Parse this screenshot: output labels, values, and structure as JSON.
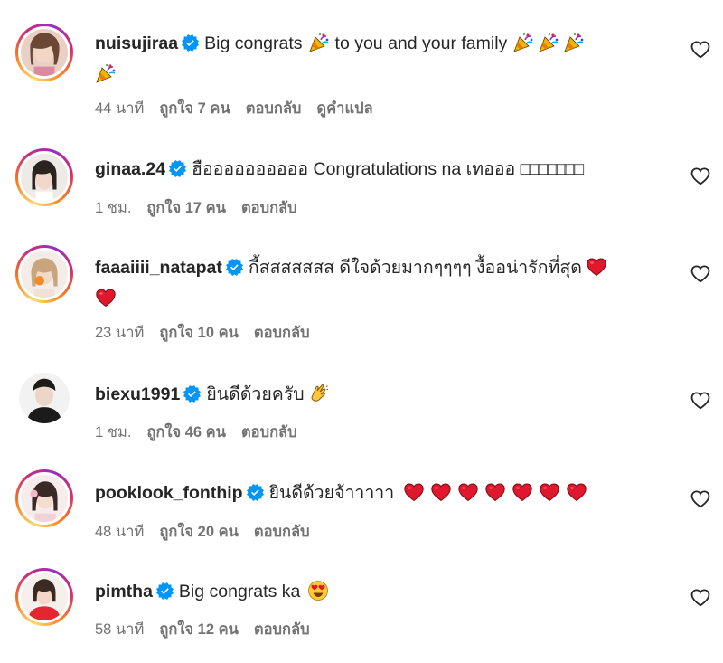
{
  "comments": [
    {
      "username": "nuisujiraa",
      "text": "Big congrats",
      "text_after": "to you and your family",
      "time": "44 นาที",
      "likes": "ถูกใจ 7 คน",
      "reply": "ตอบกลับ",
      "translate": "ดูคำแปล",
      "emoji": [
        "party-popper",
        "party-popper",
        "party-popper",
        "party-popper",
        "party-popper"
      ]
    },
    {
      "username": "ginaa.24",
      "text": "ฮืออออออออออ Congratulations na เทอออ",
      "tofu": "□□□□□□□",
      "time": "1 ชม.",
      "likes": "ถูกใจ 17 คน",
      "reply": "ตอบกลับ"
    },
    {
      "username": "faaaiiii_natapat",
      "text": "กี้สสสสสสส ดีใจด้วยมากๆๆๆๆ งื้ออน่ารักที่สุด",
      "time": "23 นาที",
      "likes": "ถูกใจ 10 คน",
      "reply": "ตอบกลับ",
      "emoji": [
        "red-heart",
        "red-heart"
      ]
    },
    {
      "username": "biexu1991",
      "text": "ยินดีด้วยครับ",
      "time": "1 ชม.",
      "likes": "ถูกใจ 46 คน",
      "reply": "ตอบกลับ",
      "emoji": [
        "clapping-hands"
      ]
    },
    {
      "username": "pooklook_fonthip",
      "text": "ยินดีด้วยจ้าาาาา",
      "time": "48 นาที",
      "likes": "ถูกใจ 20 คน",
      "reply": "ตอบกลับ",
      "emoji": [
        "red-heart",
        "red-heart",
        "red-heart",
        "red-heart",
        "red-heart",
        "red-heart",
        "red-heart"
      ]
    },
    {
      "username": "pimtha",
      "text": "Big congrats ka",
      "time": "58 นาที",
      "likes": "ถูกใจ 12 คน",
      "reply": "ตอบกลับ",
      "emoji": [
        "heart-eyes-face"
      ]
    }
  ],
  "colors": {
    "verified_blue": "#0095f6",
    "meta_gray": "#737373",
    "heart_red": "#e0182d"
  },
  "icons": {
    "verified": "verified-badge-icon",
    "like": "heart-outline-icon"
  }
}
